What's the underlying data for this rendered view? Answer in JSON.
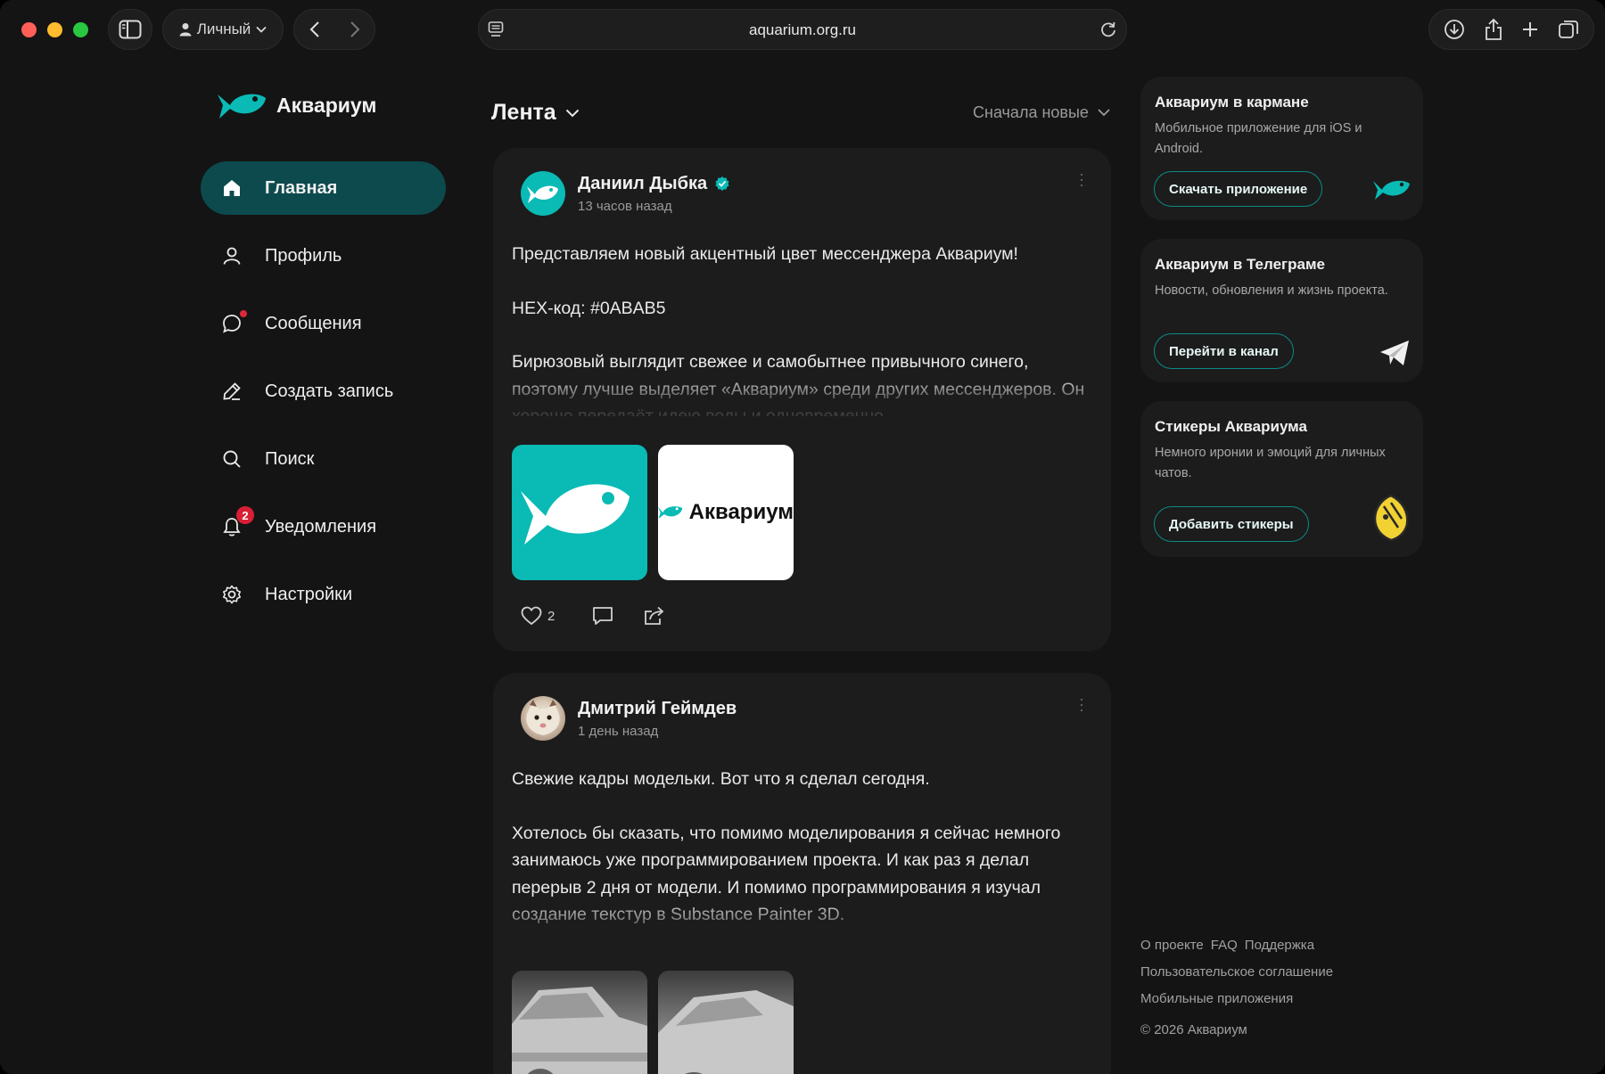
{
  "browser": {
    "profile_label": "Личный",
    "url": "aquarium.org.ru"
  },
  "brand": {
    "name": "Аквариум",
    "accent_color": "#0ABAB5"
  },
  "sidebar": {
    "items": [
      {
        "label": "Главная",
        "icon": "home-icon",
        "active": true
      },
      {
        "label": "Профиль",
        "icon": "user-icon"
      },
      {
        "label": "Сообщения",
        "icon": "chat-bubble-icon"
      },
      {
        "label": "Создать запись",
        "icon": "pencil-icon"
      },
      {
        "label": "Поиск",
        "icon": "search-icon"
      },
      {
        "label": "Уведомления",
        "icon": "bell-icon",
        "badge": "2"
      },
      {
        "label": "Настройки",
        "icon": "gear-icon"
      }
    ]
  },
  "feed": {
    "title": "Лента",
    "sort_label": "Сначала новые"
  },
  "posts": [
    {
      "author": "Даниил Дыбка",
      "time": "13 часов назад",
      "verified": true,
      "paragraphs": [
        "Представляем новый акцентный цвет мессенджера Аквариум!",
        "HEX-код: #0ABAB5",
        "Бирюзовый выглядит свежее и самобытнее привычного синего, поэтому лучше выделяет «Аквариум» среди других мессенджеров. Он хорошо передаёт идею воды и одновременно"
      ],
      "image2_text": "Аквариум",
      "likes": "2"
    },
    {
      "author": "Дмитрий Геймдев",
      "time": "1 день назад",
      "paragraphs": [
        "Свежие кадры модельки. Вот что я сделал сегодня.",
        "Хотелось бы сказать, что помимо моделирования я сейчас немного занимаюсь уже программированием проекта. И как раз я делал перерыв 2 дня от модели. И помимо программирования я изучал создание текстур в Substance Painter 3D."
      ]
    }
  ],
  "widgets": [
    {
      "title": "Аквариум в кармане",
      "desc": "Мобильное приложение для iOS и Android.",
      "button": "Скачать приложение",
      "icon": "fish-icon"
    },
    {
      "title": "Аквариум в Телеграме",
      "desc": "Новости, обновления и жизнь проекта.",
      "button": "Перейти в канал",
      "icon": "paper-plane-icon"
    },
    {
      "title": "Стикеры Аквариума",
      "desc": "Немного иронии и эмоций для личных чатов.",
      "button": "Добавить стикеры",
      "icon": "fish-sticker-icon"
    }
  ],
  "footer": {
    "links_row1": [
      "О проекте",
      "FAQ",
      "Поддержка"
    ],
    "link_agreement": "Пользовательское соглашение",
    "link_apps": "Мобильные приложения",
    "copyright": "© 2026 Аквариум"
  }
}
